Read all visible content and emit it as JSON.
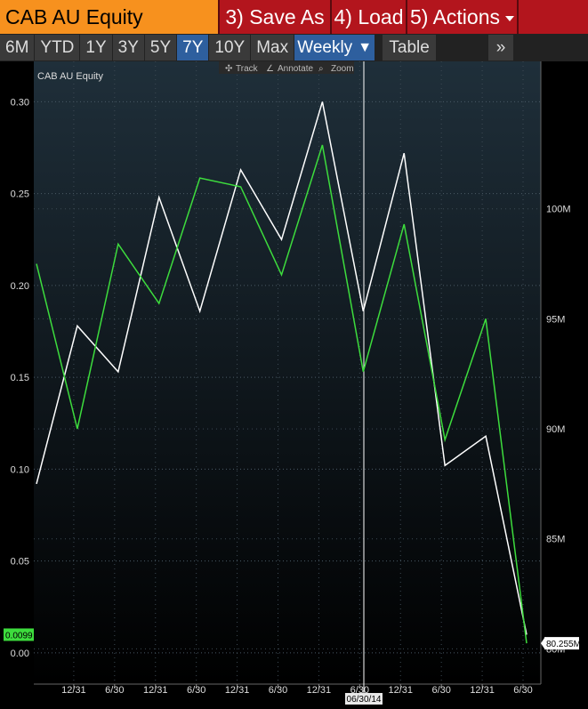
{
  "header": {
    "title": "CAB AU Equity",
    "save_label": "3) Save As",
    "load_label": "4) Load",
    "actions_label": "5) Actions"
  },
  "tabs": [
    "6M",
    "YTD",
    "1Y",
    "3Y",
    "5Y",
    "7Y",
    "10Y",
    "Max"
  ],
  "active_tab": "7Y",
  "weekly_label": "Weekly",
  "table_label": "Table",
  "more_label": "»",
  "toolbar": {
    "track": "Track",
    "annotate": "Annotate",
    "zoom": "Zoom"
  },
  "colors": {
    "series_left": "#ffffff",
    "series_right": "#3ddc3d",
    "title_bg": "#f7911e",
    "button_bg": "#b3151d",
    "active_tab": "#2e5f9e"
  },
  "chart_data": {
    "type": "line",
    "title": "CAB AU Equity",
    "x": [
      "",
      "12/31",
      "6/30",
      "12/31",
      "6/30",
      "12/31",
      "6/30",
      "12/31",
      "6/30",
      "12/31",
      "6/30",
      "12/31",
      "6/30"
    ],
    "x_tick_labels": [
      "12/31",
      "6/30",
      "12/31",
      "6/30",
      "12/31",
      "6/30",
      "12/31",
      "6/30",
      "12/31",
      "6/30",
      "12/31",
      "6/30"
    ],
    "ylim_left": [
      -0.017,
      0.322
    ],
    "ylim_right": [
      78.4,
      106.7
    ],
    "yticks_left": [
      "0.30",
      "0.25",
      "0.20",
      "0.15",
      "0.10",
      "0.05",
      "0.00"
    ],
    "yticks_right": [
      "100M",
      "95M",
      "90M",
      "85M",
      "80M"
    ],
    "series": [
      {
        "axis": "left",
        "color": "#ffffff",
        "values": [
          0.092,
          0.178,
          0.153,
          0.248,
          0.186,
          0.263,
          0.225,
          0.3,
          0.186,
          0.272,
          0.102,
          0.118,
          0.0099
        ]
      },
      {
        "axis": "right",
        "color": "#3ddc3d",
        "values": [
          97.5,
          90.0,
          98.4,
          95.7,
          101.4,
          101.0,
          97.0,
          102.9,
          92.6,
          99.3,
          89.5,
          95.0,
          80.255
        ]
      }
    ],
    "last_value_left": "0.0099",
    "last_value_right": "80.255M",
    "crosshair_label": "06/30/14",
    "grid": true
  }
}
